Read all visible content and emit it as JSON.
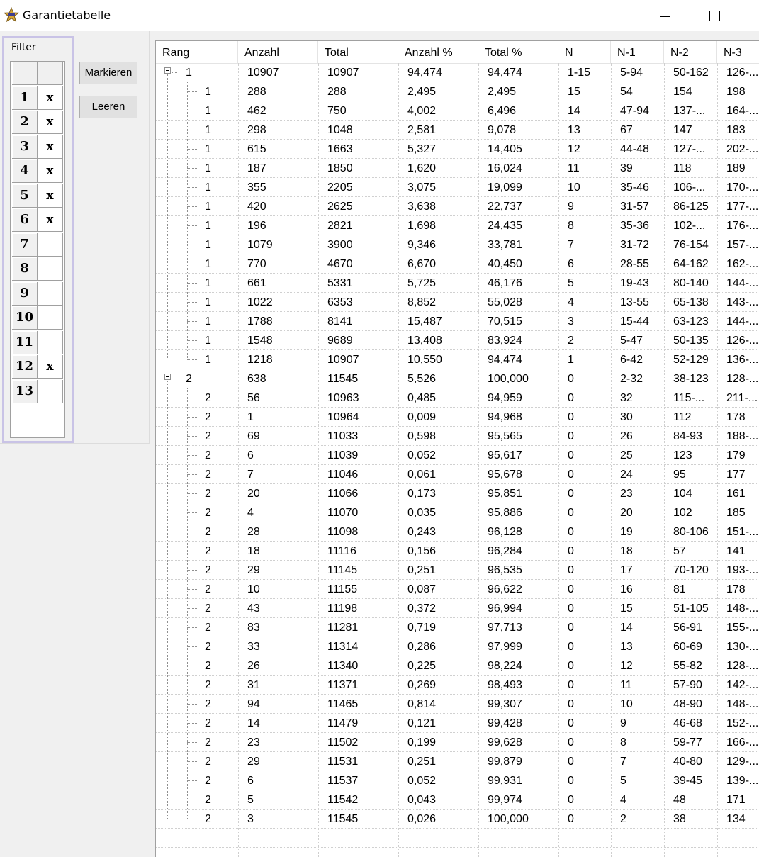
{
  "window": {
    "title": "Garantietabelle"
  },
  "filter": {
    "caption": "Filter",
    "items": [
      {
        "num": "1",
        "mark": "x"
      },
      {
        "num": "2",
        "mark": "x"
      },
      {
        "num": "3",
        "mark": "x"
      },
      {
        "num": "4",
        "mark": "x"
      },
      {
        "num": "5",
        "mark": "x"
      },
      {
        "num": "6",
        "mark": "x"
      },
      {
        "num": "7",
        "mark": ""
      },
      {
        "num": "8",
        "mark": ""
      },
      {
        "num": "9",
        "mark": ""
      },
      {
        "num": "10",
        "mark": ""
      },
      {
        "num": "11",
        "mark": ""
      },
      {
        "num": "12",
        "mark": "x"
      },
      {
        "num": "13",
        "mark": ""
      }
    ]
  },
  "buttons": {
    "mark_label": "Markieren",
    "clear_label": "Leeren"
  },
  "table": {
    "columns": [
      "Rang",
      "Anzahl",
      "Total",
      "Anzahl %",
      "Total %",
      "N",
      "N-1",
      "N-2",
      "N-3"
    ],
    "groups": [
      {
        "values": [
          "1",
          "10907",
          "10907",
          "94,474",
          "94,474",
          "1-15",
          "5-94",
          "50-162",
          "126-..."
        ],
        "rows": [
          [
            "1",
            "288",
            "288",
            "2,495",
            "2,495",
            "15",
            "54",
            "154",
            "198"
          ],
          [
            "1",
            "462",
            "750",
            "4,002",
            "6,496",
            "14",
            "47-94",
            "137-...",
            "164-..."
          ],
          [
            "1",
            "298",
            "1048",
            "2,581",
            "9,078",
            "13",
            "67",
            "147",
            "183"
          ],
          [
            "1",
            "615",
            "1663",
            "5,327",
            "14,405",
            "12",
            "44-48",
            "127-...",
            "202-..."
          ],
          [
            "1",
            "187",
            "1850",
            "1,620",
            "16,024",
            "11",
            "39",
            "118",
            "189"
          ],
          [
            "1",
            "355",
            "2205",
            "3,075",
            "19,099",
            "10",
            "35-46",
            "106-...",
            "170-..."
          ],
          [
            "1",
            "420",
            "2625",
            "3,638",
            "22,737",
            "9",
            "31-57",
            "86-125",
            "177-..."
          ],
          [
            "1",
            "196",
            "2821",
            "1,698",
            "24,435",
            "8",
            "35-36",
            "102-...",
            "176-..."
          ],
          [
            "1",
            "1079",
            "3900",
            "9,346",
            "33,781",
            "7",
            "31-72",
            "76-154",
            "157-..."
          ],
          [
            "1",
            "770",
            "4670",
            "6,670",
            "40,450",
            "6",
            "28-55",
            "64-162",
            "162-..."
          ],
          [
            "1",
            "661",
            "5331",
            "5,725",
            "46,176",
            "5",
            "19-43",
            "80-140",
            "144-..."
          ],
          [
            "1",
            "1022",
            "6353",
            "8,852",
            "55,028",
            "4",
            "13-55",
            "65-138",
            "143-..."
          ],
          [
            "1",
            "1788",
            "8141",
            "15,487",
            "70,515",
            "3",
            "15-44",
            "63-123",
            "144-..."
          ],
          [
            "1",
            "1548",
            "9689",
            "13,408",
            "83,924",
            "2",
            "5-47",
            "50-135",
            "126-..."
          ],
          [
            "1",
            "1218",
            "10907",
            "10,550",
            "94,474",
            "1",
            "6-42",
            "52-129",
            "136-..."
          ]
        ]
      },
      {
        "values": [
          "2",
          "638",
          "11545",
          "5,526",
          "100,000",
          "0",
          "2-32",
          "38-123",
          "128-..."
        ],
        "rows": [
          [
            "2",
            "56",
            "10963",
            "0,485",
            "94,959",
            "0",
            "32",
            "115-...",
            "211-..."
          ],
          [
            "2",
            "1",
            "10964",
            "0,009",
            "94,968",
            "0",
            "30",
            "112",
            "178"
          ],
          [
            "2",
            "69",
            "11033",
            "0,598",
            "95,565",
            "0",
            "26",
            "84-93",
            "188-..."
          ],
          [
            "2",
            "6",
            "11039",
            "0,052",
            "95,617",
            "0",
            "25",
            "123",
            "179"
          ],
          [
            "2",
            "7",
            "11046",
            "0,061",
            "95,678",
            "0",
            "24",
            "95",
            "177"
          ],
          [
            "2",
            "20",
            "11066",
            "0,173",
            "95,851",
            "0",
            "23",
            "104",
            "161"
          ],
          [
            "2",
            "4",
            "11070",
            "0,035",
            "95,886",
            "0",
            "20",
            "102",
            "185"
          ],
          [
            "2",
            "28",
            "11098",
            "0,243",
            "96,128",
            "0",
            "19",
            "80-106",
            "151-..."
          ],
          [
            "2",
            "18",
            "11116",
            "0,156",
            "96,284",
            "0",
            "18",
            "57",
            "141"
          ],
          [
            "2",
            "29",
            "11145",
            "0,251",
            "96,535",
            "0",
            "17",
            "70-120",
            "193-..."
          ],
          [
            "2",
            "10",
            "11155",
            "0,087",
            "96,622",
            "0",
            "16",
            "81",
            "178"
          ],
          [
            "2",
            "43",
            "11198",
            "0,372",
            "96,994",
            "0",
            "15",
            "51-105",
            "148-..."
          ],
          [
            "2",
            "83",
            "11281",
            "0,719",
            "97,713",
            "0",
            "14",
            "56-91",
            "155-..."
          ],
          [
            "2",
            "33",
            "11314",
            "0,286",
            "97,999",
            "0",
            "13",
            "60-69",
            "130-..."
          ],
          [
            "2",
            "26",
            "11340",
            "0,225",
            "98,224",
            "0",
            "12",
            "55-82",
            "128-..."
          ],
          [
            "2",
            "31",
            "11371",
            "0,269",
            "98,493",
            "0",
            "11",
            "57-90",
            "142-..."
          ],
          [
            "2",
            "94",
            "11465",
            "0,814",
            "99,307",
            "0",
            "10",
            "48-90",
            "148-..."
          ],
          [
            "2",
            "14",
            "11479",
            "0,121",
            "99,428",
            "0",
            "9",
            "46-68",
            "152-..."
          ],
          [
            "2",
            "23",
            "11502",
            "0,199",
            "99,628",
            "0",
            "8",
            "59-77",
            "166-..."
          ],
          [
            "2",
            "29",
            "11531",
            "0,251",
            "99,879",
            "0",
            "7",
            "40-80",
            "129-..."
          ],
          [
            "2",
            "6",
            "11537",
            "0,052",
            "99,931",
            "0",
            "5",
            "39-45",
            "139-..."
          ],
          [
            "2",
            "5",
            "11542",
            "0,043",
            "99,974",
            "0",
            "4",
            "48",
            "171"
          ],
          [
            "2",
            "3",
            "11545",
            "0,026",
            "100,000",
            "0",
            "2",
            "38",
            "134"
          ]
        ]
      }
    ]
  }
}
